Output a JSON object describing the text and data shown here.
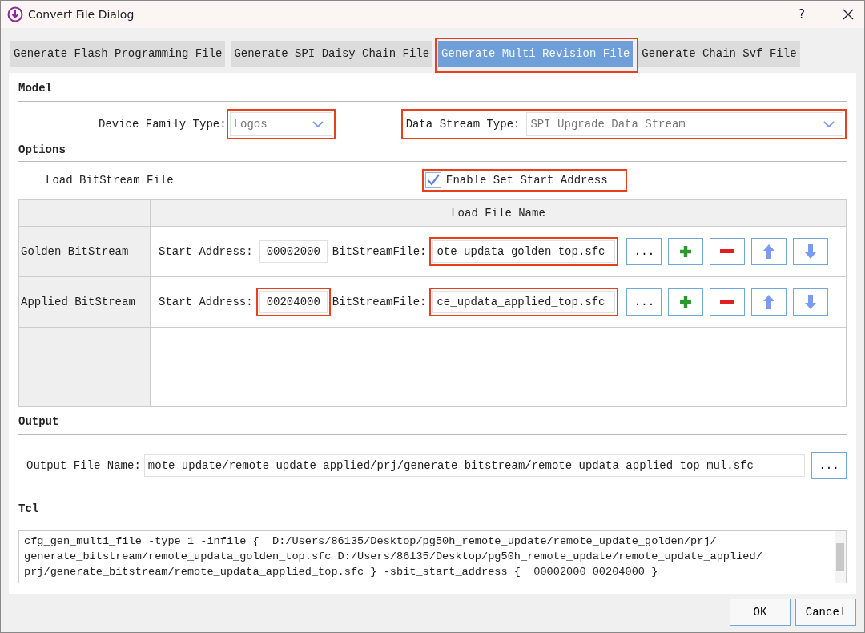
{
  "window": {
    "title": "Convert File Dialog",
    "help": "?"
  },
  "tabs": [
    {
      "label": "Generate Flash Programming File",
      "selected": false,
      "highlighted": false
    },
    {
      "label": "Generate SPI Daisy Chain File",
      "selected": false,
      "highlighted": false
    },
    {
      "label": "Generate Multi Revision File",
      "selected": true,
      "highlighted": true
    },
    {
      "label": "Generate Chain Svf File",
      "selected": false,
      "highlighted": false
    }
  ],
  "model": {
    "heading": "Model",
    "device_family": {
      "label": "Device Family Type:",
      "value": "Logos",
      "highlighted": true
    },
    "data_stream": {
      "label": "Data Stream Type:",
      "value": "SPI Upgrade Data Stream",
      "highlighted": true
    }
  },
  "options": {
    "heading": "Options",
    "load_label": "Load BitStream File",
    "enable_start": {
      "label": "Enable Set Start Address",
      "checked": true,
      "highlighted": true
    }
  },
  "table": {
    "column_header": "Load File Name",
    "rows": [
      {
        "name": "Golden BitStream",
        "start_label": "Start Address:",
        "start": "00002000",
        "start_highlighted": false,
        "file_label": "BitStreamFile:",
        "file": "ote_updata_golden_top.sfc",
        "file_highlighted": true,
        "browse": "..."
      },
      {
        "name": "Applied BitStream",
        "start_label": "Start Address:",
        "start": "00204000",
        "start_highlighted": true,
        "file_label": "BitStreamFile:",
        "file": "ce_updata_applied_top.sfc",
        "file_highlighted": true,
        "browse": "..."
      }
    ]
  },
  "output": {
    "heading": "Output",
    "label": "Output File Name:",
    "value": "mote_update/remote_update_applied/prj/generate_bitstream/remote_updata_applied_top_mul.sfc",
    "browse": "..."
  },
  "tcl": {
    "heading": "Tcl",
    "lines": [
      "cfg_gen_multi_file -type 1 -infile {  D:/Users/86135/Desktop/pg50h_remote_update/remote_update_golden/prj/",
      "generate_bitstream/remote_updata_golden_top.sfc D:/Users/86135/Desktop/pg50h_remote_update/remote_update_applied/",
      "prj/generate_bitstream/remote_updata_applied_top.sfc } -sbit_start_address {  00002000 00204000 }"
    ]
  },
  "buttons": [
    "OK",
    "Cancel"
  ]
}
